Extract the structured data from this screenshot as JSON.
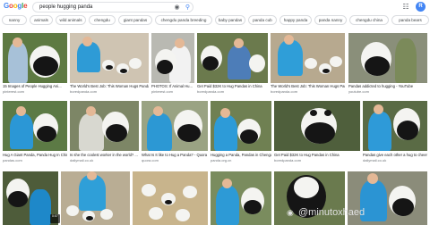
{
  "header": {
    "logo_letters": [
      "G",
      "o",
      "o",
      "g",
      "l",
      "e"
    ],
    "logo_colors": [
      "#4285F4",
      "#EA4335",
      "#FBBC05",
      "#4285F4",
      "#34A853",
      "#EA4335"
    ],
    "query": "people hugging panda",
    "camera_icon": "camera-icon",
    "search_icon": "search-icon",
    "apps_icon": "apps-grid-icon",
    "avatar_initial": "R"
  },
  "chips": [
    "nanny",
    "animals",
    "wild animals",
    "chengdu",
    "giant pandas",
    "chengdu panda breeding",
    "baby pandas",
    "panda cub",
    "happy panda",
    "panda nanny",
    "chengdu china",
    "panda bears"
  ],
  "results": [
    {
      "caption": "15 Images of People Hugging Ani...",
      "source": "pinterest.com"
    },
    {
      "caption": "The World's Best Job: This Woman Hugs Pandas A...",
      "source": "boredpanda.com"
    },
    {
      "caption": "PHOTOS: If Animal Hu...",
      "source": "pinterest.com"
    },
    {
      "caption": "Get Paid $32K to Hug Pandas in China",
      "source": "boredpanda.com"
    },
    {
      "caption": "The World's Best Job: This Woman Hugs Pandas A...",
      "source": "boredpanda.com"
    },
    {
      "caption": "Pandas addicted to hugging - YouTube",
      "source": "youtube.com"
    },
    {
      "caption": "Hug A Giant Panda, Panda Hug In China ...",
      "source": "pandas.com"
    },
    {
      "caption": "Is she the coolest worker in the world? ...",
      "source": "dailymail.co.uk"
    },
    {
      "caption": "What Is It like to Hug a Panda? - Quora",
      "source": "quora.com"
    },
    {
      "caption": "Hugging a Panda, Pandas in Chengdu, China ...",
      "source": "panda.org.cn"
    },
    {
      "caption": "Get Paid $32K to Hug Pandas in China",
      "source": "boredpanda.com"
    },
    {
      "caption": "Pandas give each other a hug to cheer...",
      "source": "dailymail.co.uk"
    }
  ],
  "overlay": {
    "duration": "0:07"
  },
  "watermark": {
    "text": "@minutoxhaed",
    "icon": "weibo-icon"
  }
}
